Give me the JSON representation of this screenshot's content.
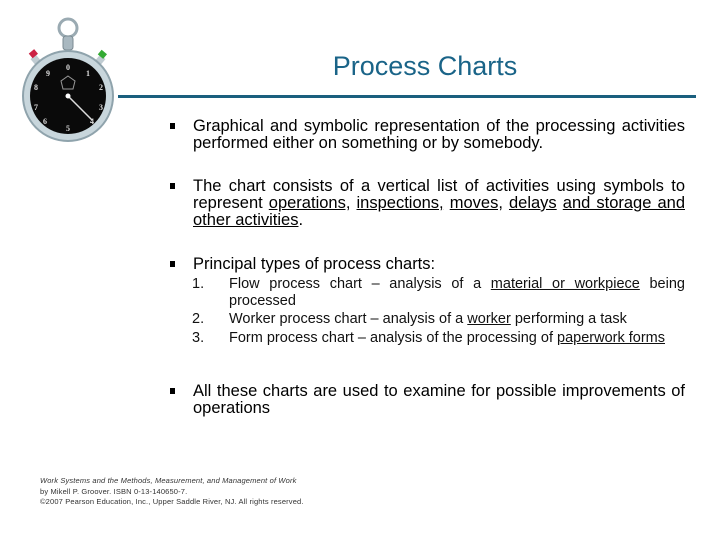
{
  "slide": {
    "title": "Process Charts",
    "icon": "stopwatch-icon",
    "bullets": [
      {
        "segments": [
          {
            "text": "Graphical and symbolic representation of the processing activities performed either on something or by somebody.",
            "u": false
          }
        ]
      },
      {
        "segments": [
          {
            "text": "The chart consists of a vertical list of activities using symbols to represent ",
            "u": false
          },
          {
            "text": "operations,",
            "u": true
          },
          {
            "text": " ",
            "u": false
          },
          {
            "text": "inspections,",
            "u": true
          },
          {
            "text": " ",
            "u": false
          },
          {
            "text": "moves,",
            "u": true
          },
          {
            "text": " ",
            "u": false
          },
          {
            "text": "delays",
            "u": true
          },
          {
            "text": " ",
            "u": false
          },
          {
            "text": "and storage and other activities",
            "u": true
          },
          {
            "text": ".",
            "u": false
          }
        ]
      },
      {
        "segments": [
          {
            "text": "Principal types of process charts:",
            "u": false
          }
        ]
      },
      {
        "segments": [
          {
            "text": "All these charts are used to examine for possible improvements of operations",
            "u": false
          }
        ]
      }
    ],
    "sublist": [
      {
        "num": "1.",
        "segments": [
          {
            "text": "Flow process chart – analysis of a ",
            "u": false
          },
          {
            "text": "material or workpiece",
            "u": true
          },
          {
            "text": " being processed",
            "u": false
          }
        ]
      },
      {
        "num": "2.",
        "segments": [
          {
            "text": "Worker process chart – analysis of a ",
            "u": false
          },
          {
            "text": "worker",
            "u": true
          },
          {
            "text": " performing a task",
            "u": false
          }
        ]
      },
      {
        "num": "3.",
        "segments": [
          {
            "text": "Form process chart – analysis of the processing of ",
            "u": false
          },
          {
            "text": "paperwork forms",
            "u": true
          }
        ]
      }
    ],
    "footer": {
      "line1": "Work Systems and the Methods, Measurement, and Management of Work",
      "line2": "by Mikell P. Groover. ISBN 0-13-140650-7.",
      "line3": "©2007 Pearson Education, Inc., Upper Saddle River, NJ.  All rights reserved."
    }
  },
  "colors": {
    "title": "#1a6488",
    "rule": "#1a5f7e"
  }
}
